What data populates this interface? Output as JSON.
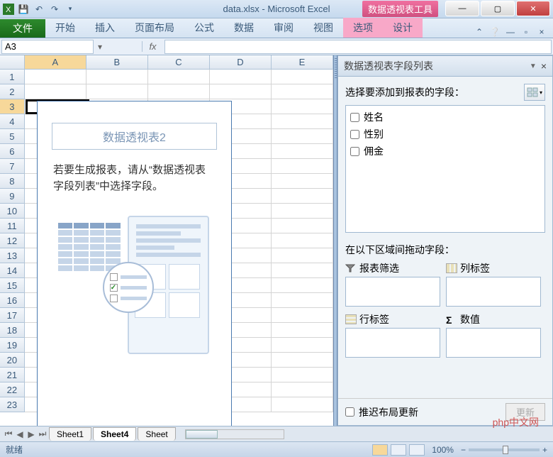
{
  "title_bar": {
    "filename": "data.xlsx",
    "app": "Microsoft Excel",
    "full": "data.xlsx - Microsoft Excel",
    "context_tool": "数据透视表工具"
  },
  "ribbon": {
    "file": "文件",
    "tabs": [
      "开始",
      "插入",
      "页面布局",
      "公式",
      "数据",
      "审阅",
      "视图"
    ],
    "context_tabs": [
      "选项",
      "设计"
    ]
  },
  "name_box": "A3",
  "fx": "fx",
  "columns": [
    "A",
    "B",
    "C",
    "D",
    "E"
  ],
  "row_nums": [
    1,
    2,
    3,
    4,
    5,
    6,
    7,
    8,
    9,
    10,
    11,
    12,
    13,
    14,
    15,
    16,
    17,
    18,
    19,
    20,
    21,
    22,
    23
  ],
  "pivot_placeholder": {
    "title": "数据透视表2",
    "instruction": "若要生成报表，请从“数据透视表字段列表”中选择字段。"
  },
  "field_pane": {
    "title": "数据透视表字段列表",
    "choose_label": "选择要添加到报表的字段：",
    "fields": [
      "姓名",
      "性别",
      "佣金"
    ],
    "drag_label": "在以下区域间拖动字段：",
    "areas": {
      "filter": "报表筛选",
      "columns": "列标签",
      "rows": "行标签",
      "values": "数值"
    },
    "defer": "推迟布局更新",
    "update": "更新"
  },
  "sheet_tabs": [
    "Sheet1",
    "Sheet4",
    "Sheet"
  ],
  "status": {
    "ready": "就绪",
    "zoom": "100%"
  },
  "watermark": "php中文网",
  "sigma_symbol": "Σ",
  "filter_symbol": "▼"
}
